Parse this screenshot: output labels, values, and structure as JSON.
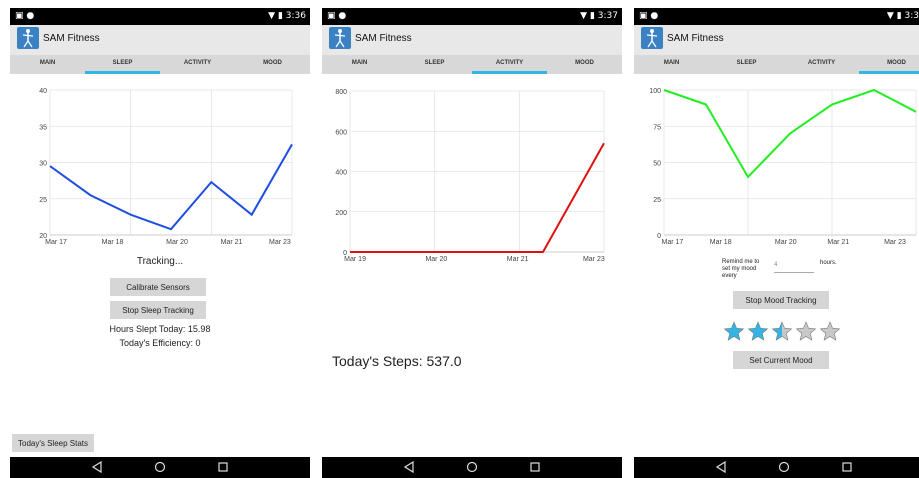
{
  "phones": [
    {
      "status_time": "3:36",
      "app_title": "SAM Fitness",
      "tabs": [
        "MAIN",
        "SLEEP",
        "ACTIVITY",
        "MOOD"
      ],
      "active_tab": "SLEEP",
      "tracking_text": "Tracking...",
      "calibrate_label": "Calibrate Sensors",
      "stop_label": "Stop Sleep Tracking",
      "hours_text": "Hours Slept Today: 15.98",
      "efficiency_text": "Today's Efficiency: 0",
      "stats_label": "Today's Sleep Stats"
    },
    {
      "status_time": "3:37",
      "app_title": "SAM Fitness",
      "tabs": [
        "MAIN",
        "SLEEP",
        "ACTIVITY",
        "MOOD"
      ],
      "active_tab": "ACTIVITY",
      "steps_text": "Today's Steps: 537.0"
    },
    {
      "status_time": "3:3",
      "app_title": "SAM Fitness",
      "tabs": [
        "MAIN",
        "SLEEP",
        "ACTIVITY",
        "MOOD"
      ],
      "active_tab": "MOOD",
      "remind_text": [
        "Remind me to",
        "set my mood",
        "every"
      ],
      "remind_value": "4",
      "hours_label": "hours.",
      "stop_label": "Stop Mood Tracking",
      "rating": 2.5,
      "max_rating": 5,
      "set_label": "Set Current Mood"
    }
  ],
  "chart_data": [
    {
      "type": "line",
      "color": "#1f4fe0",
      "x": [
        "Mar 17",
        "Mar 18",
        "Mar 20",
        "Mar 21",
        "Mar 23"
      ],
      "x_labels": [
        "Mar 17",
        "Mar 18",
        "Mar 20",
        "Mar 21",
        "Mar 23"
      ],
      "points": [
        [
          0,
          29.5
        ],
        [
          1,
          25.5
        ],
        [
          2,
          22.8
        ],
        [
          3,
          20.8
        ],
        [
          4,
          27.3
        ],
        [
          5,
          22.8
        ],
        [
          6,
          32.5
        ]
      ],
      "yticks": [
        "40",
        "35",
        "30",
        "25",
        "20"
      ],
      "ylim": [
        20,
        40
      ]
    },
    {
      "type": "line",
      "color": "#e01010",
      "x_labels": [
        "Mar 19",
        "Mar 20",
        "Mar 21",
        "Mar 23"
      ],
      "points": [
        [
          0,
          0
        ],
        [
          3.8,
          0
        ],
        [
          5,
          540
        ]
      ],
      "yticks": [
        "800",
        "600",
        "400",
        "200",
        "0"
      ],
      "ylim": [
        0,
        800
      ]
    },
    {
      "type": "line",
      "color": "#22ee22",
      "x_labels": [
        "Mar 17",
        "Mar 18",
        "Mar 20",
        "Mar 21",
        "Mar 23"
      ],
      "points": [
        [
          0,
          100
        ],
        [
          1,
          90
        ],
        [
          2,
          40
        ],
        [
          3,
          70
        ],
        [
          4,
          90
        ],
        [
          5,
          100
        ],
        [
          6,
          85
        ]
      ],
      "yticks": [
        "100",
        "75",
        "50",
        "25",
        "0"
      ],
      "ylim": [
        0,
        100
      ]
    }
  ]
}
